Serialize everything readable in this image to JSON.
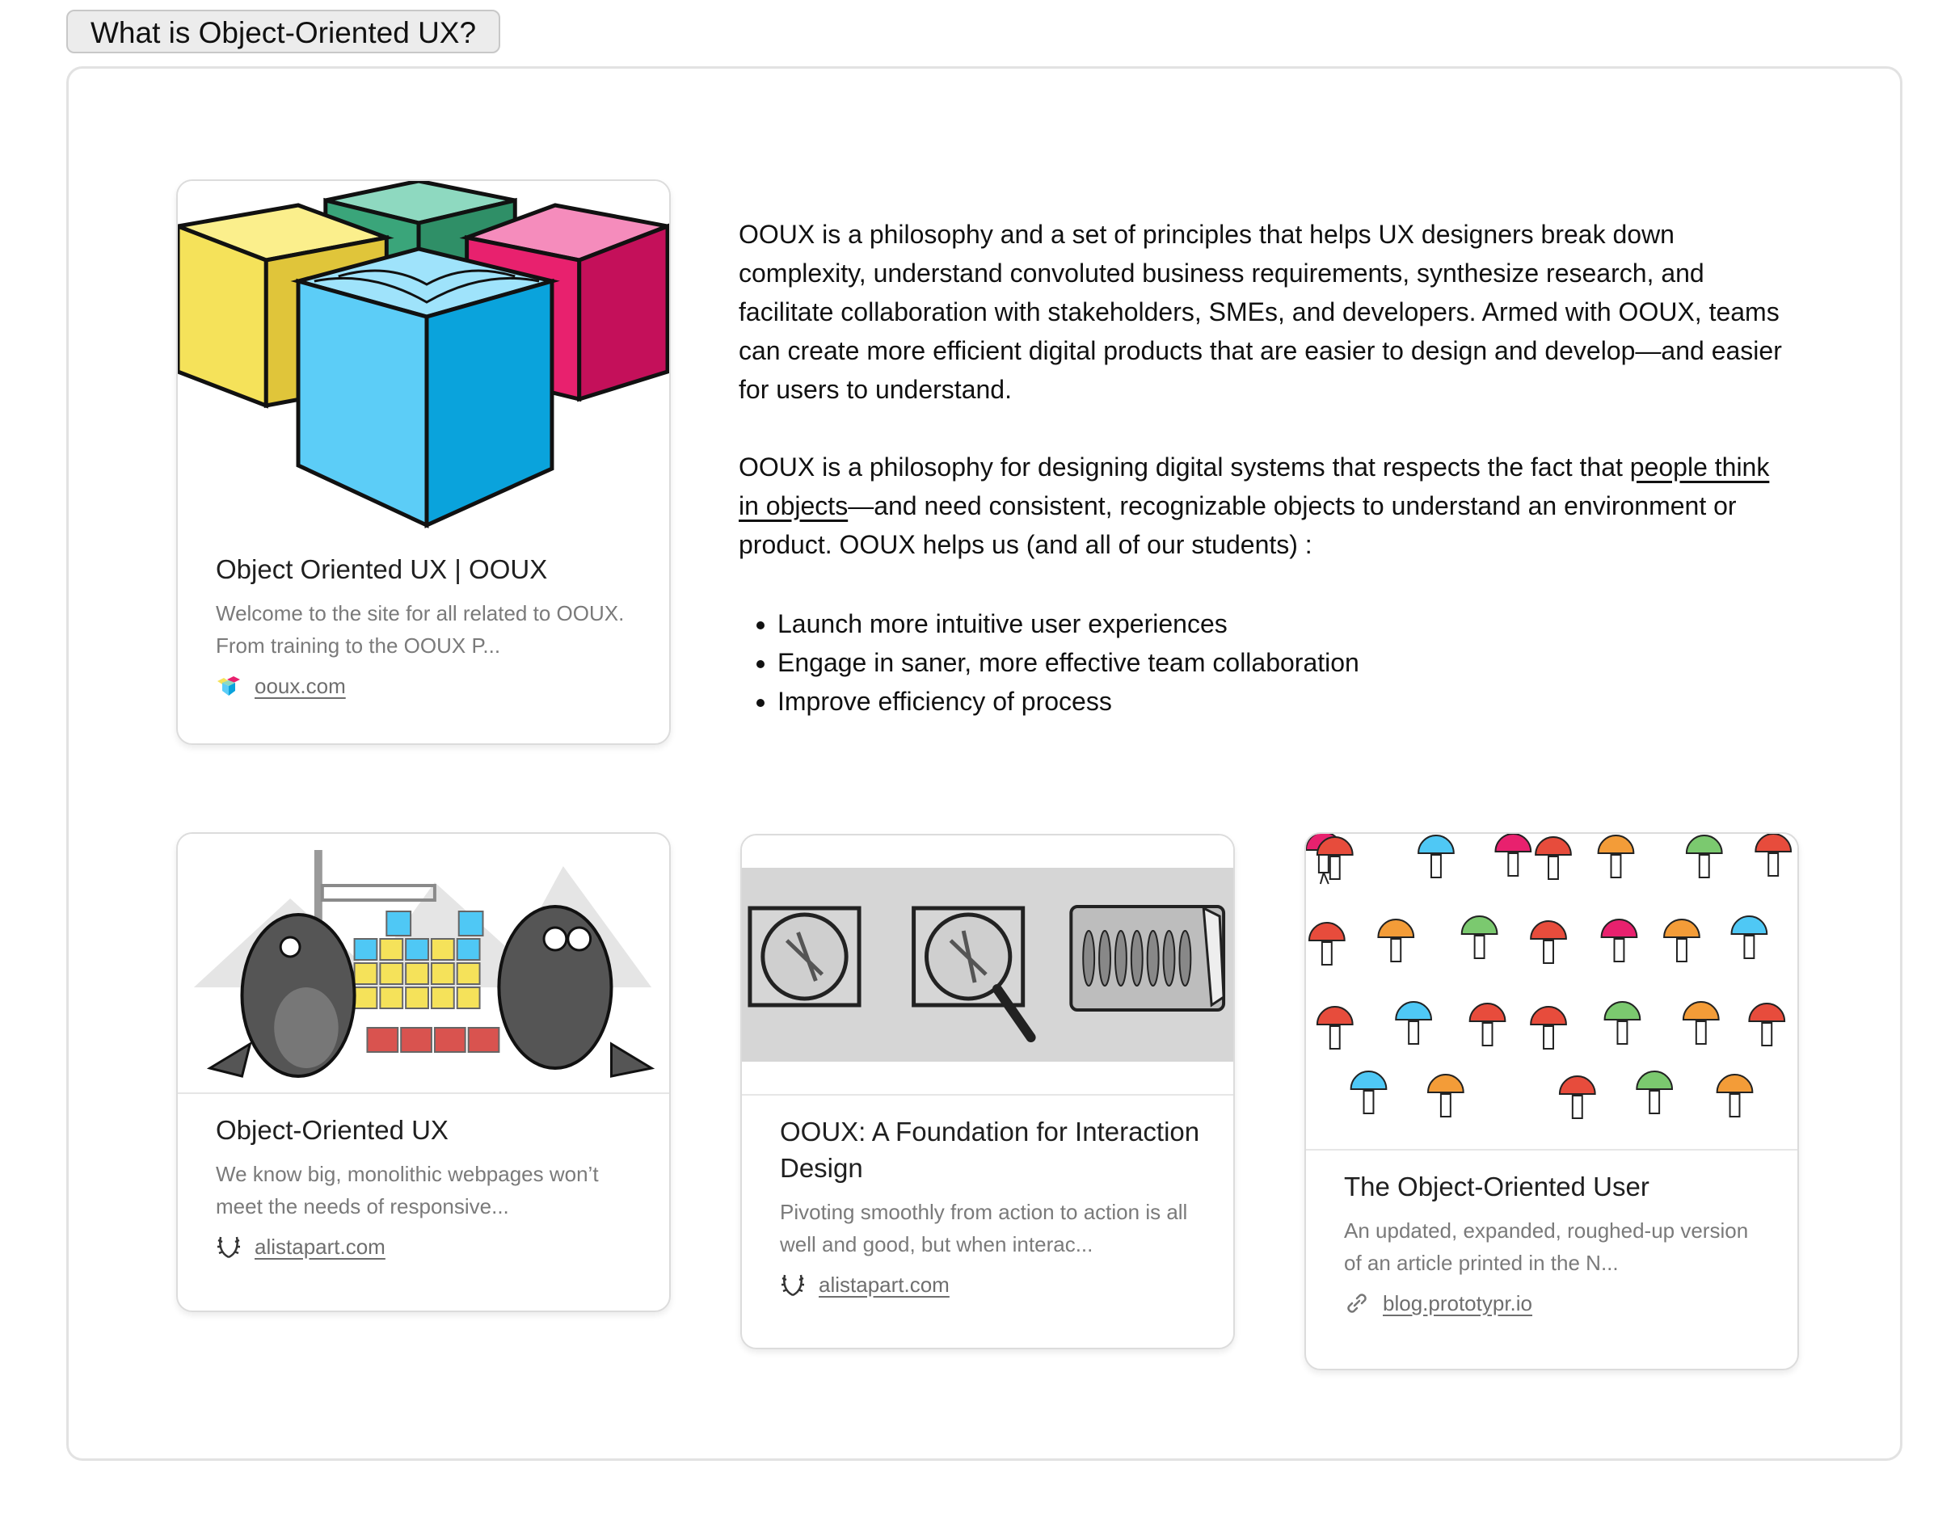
{
  "tab": {
    "label": "What is Object-Oriented UX?"
  },
  "intro": {
    "p1": "OOUX is a philosophy and a set of principles that helps UX designers break down complexity, understand convoluted business requirements, synthesize research, and facilitate collaboration with stakeholders, SMEs, and developers.  Armed with OOUX, teams can create more efficient digital products that are easier to design and develop—and easier for users to understand.",
    "p2_before": "OOUX is a philosophy for designing digital systems that respects the fact that ",
    "p2_link": "people think in objects",
    "p2_after": "—and need consistent, recognizable objects to understand an environment or product. OOUX helps us (and all of our students) :",
    "bullets": [
      "Launch more intuitive user experiences",
      "Engage in saner, more effective team collaboration",
      "Improve efficiency of process"
    ]
  },
  "cards": [
    {
      "title": "Object Oriented UX | OOUX",
      "desc": "Welcome to the site for all related to OOUX. From training to the OOUX P...",
      "domain": "ooux.com",
      "favicon": "ooux-cubes-icon"
    },
    {
      "title": "Object-Oriented UX",
      "desc": "We know big, monolithic webpages won’t meet the needs of responsive...",
      "domain": "alistapart.com",
      "favicon": "alistapart-laurel-icon"
    },
    {
      "title": "OOUX: A Foundation for Interaction Design",
      "desc": "Pivoting smoothly from action to action is all well and good, but when interac...",
      "domain": "alistapart.com",
      "favicon": "alistapart-laurel-icon"
    },
    {
      "title": "The Object-Oriented User",
      "desc": "An updated, expanded, roughed-up version of an article printed in the N...",
      "domain": "blog.prototypr.io",
      "favicon": "link-icon"
    }
  ],
  "colors": {
    "cube_yellow": "#f5e25a",
    "cube_green": "#8ed9c0",
    "cube_pink": "#e8216e",
    "cube_blue": "#4fc8f5"
  }
}
